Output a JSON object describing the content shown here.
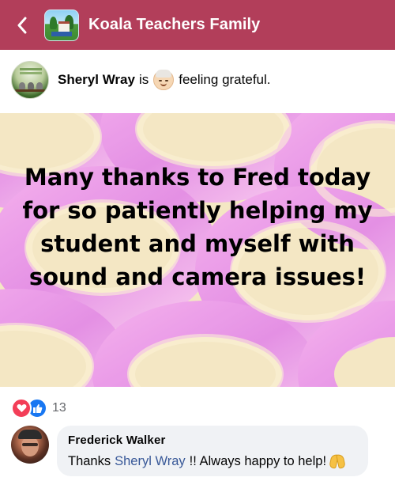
{
  "header": {
    "title": "Koala Teachers Family",
    "back_icon": "chevron-left-icon",
    "background_color": "#b23e5a"
  },
  "post": {
    "author": "Sheryl Wray",
    "verb": "is",
    "feeling_emoji": "older-woman-emoji",
    "feeling": "feeling grateful.",
    "image_text": "Many thanks to Fred today for so patiently helping my student and myself with sound and camera issues!"
  },
  "reactions": {
    "icons": [
      "love-reaction-icon",
      "like-reaction-icon"
    ],
    "count": "13"
  },
  "comment": {
    "author": "Frederick Walker",
    "text_before": "Thanks",
    "mention": "Sheryl Wray",
    "text_after": "!! Always happy to help!",
    "emoji": "folded-hands-emoji"
  },
  "colors": {
    "like_blue": "#1877f2",
    "love_red": "#f33e58",
    "mention_blue": "#385898",
    "bubble_gray": "#f0f2f5"
  }
}
